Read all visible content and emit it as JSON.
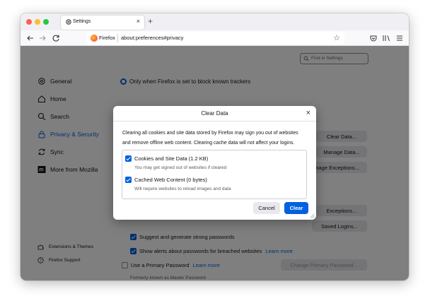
{
  "browser": {
    "tab_title": "Settings",
    "close_tab": "×",
    "new_tab": "+",
    "identity_label": "Firefox",
    "url": "about:preferences#privacy",
    "bookmark_star": "☆"
  },
  "sidebar": {
    "items": [
      {
        "label": "General",
        "icon": "gear-icon"
      },
      {
        "label": "Home",
        "icon": "home-icon"
      },
      {
        "label": "Search",
        "icon": "search-icon"
      },
      {
        "label": "Privacy & Security",
        "icon": "lock-icon",
        "selected": true
      },
      {
        "label": "Sync",
        "icon": "sync-icon"
      },
      {
        "label": "More from Mozilla",
        "icon": "mozilla-icon"
      }
    ],
    "footer": [
      {
        "label": "Extensions & Themes",
        "icon": "puzzle-icon"
      },
      {
        "label": "Firefox Support",
        "icon": "help-icon"
      }
    ]
  },
  "settings": {
    "search_placeholder": "Find in Settings",
    "tracker_option": "Only when Firefox is set to block known trackers",
    "clear_data_btn": "Clear Data...",
    "manage_data_btn": "Manage Data...",
    "manage_exceptions_btn": "Manage Exceptions...",
    "exceptions_btn": "Exceptions...",
    "saved_logins_btn": "Saved Logins...",
    "suggest_passwords": "Suggest and generate strong passwords",
    "breach_alerts": "Show alerts about passwords for breached websites",
    "learn_more_1": "Learn more",
    "primary_password": "Use a Primary Password",
    "learn_more_2": "Learn more",
    "change_primary_btn": "Change Primary Password...",
    "master_note": "Formerly known as Master Password"
  },
  "dialog": {
    "title": "Clear Data",
    "close": "×",
    "desc_line1": "Clearing all cookies and site data stored by Firefox may sign you out of websites",
    "desc_line2": "and remove offline web content. Clearing cache data will not affect your logins.",
    "options": [
      {
        "label": "Cookies and Site Data (1.2 KB)",
        "hint": "You may get signed out of websites if cleared",
        "checked": true
      },
      {
        "label": "Cached Web Content (0 bytes)",
        "hint": "Will require websites to reload images and data",
        "checked": true
      }
    ],
    "cancel": "Cancel",
    "clear": "Clear"
  },
  "colors": {
    "accent": "#0061e0",
    "overlay": "rgba(0,0,0,0.5)"
  }
}
